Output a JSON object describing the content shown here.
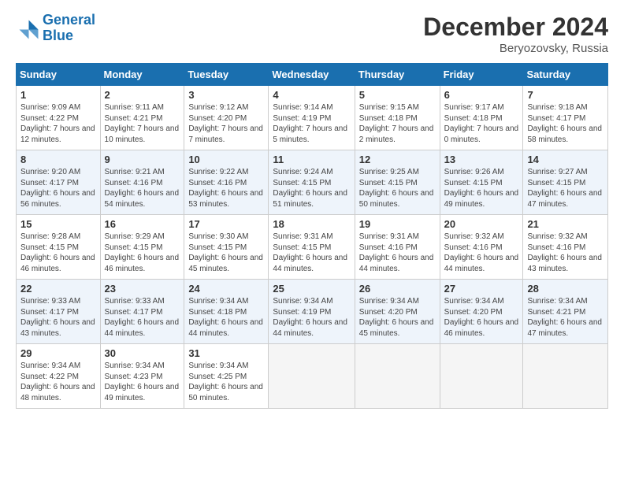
{
  "header": {
    "logo_line1": "General",
    "logo_line2": "Blue",
    "month": "December 2024",
    "location": "Beryozovsky, Russia"
  },
  "weekdays": [
    "Sunday",
    "Monday",
    "Tuesday",
    "Wednesday",
    "Thursday",
    "Friday",
    "Saturday"
  ],
  "weeks": [
    [
      {
        "day": "1",
        "sunrise": "Sunrise: 9:09 AM",
        "sunset": "Sunset: 4:22 PM",
        "daylight": "Daylight: 7 hours and 12 minutes."
      },
      {
        "day": "2",
        "sunrise": "Sunrise: 9:11 AM",
        "sunset": "Sunset: 4:21 PM",
        "daylight": "Daylight: 7 hours and 10 minutes."
      },
      {
        "day": "3",
        "sunrise": "Sunrise: 9:12 AM",
        "sunset": "Sunset: 4:20 PM",
        "daylight": "Daylight: 7 hours and 7 minutes."
      },
      {
        "day": "4",
        "sunrise": "Sunrise: 9:14 AM",
        "sunset": "Sunset: 4:19 PM",
        "daylight": "Daylight: 7 hours and 5 minutes."
      },
      {
        "day": "5",
        "sunrise": "Sunrise: 9:15 AM",
        "sunset": "Sunset: 4:18 PM",
        "daylight": "Daylight: 7 hours and 2 minutes."
      },
      {
        "day": "6",
        "sunrise": "Sunrise: 9:17 AM",
        "sunset": "Sunset: 4:18 PM",
        "daylight": "Daylight: 7 hours and 0 minutes."
      },
      {
        "day": "7",
        "sunrise": "Sunrise: 9:18 AM",
        "sunset": "Sunset: 4:17 PM",
        "daylight": "Daylight: 6 hours and 58 minutes."
      }
    ],
    [
      {
        "day": "8",
        "sunrise": "Sunrise: 9:20 AM",
        "sunset": "Sunset: 4:17 PM",
        "daylight": "Daylight: 6 hours and 56 minutes."
      },
      {
        "day": "9",
        "sunrise": "Sunrise: 9:21 AM",
        "sunset": "Sunset: 4:16 PM",
        "daylight": "Daylight: 6 hours and 54 minutes."
      },
      {
        "day": "10",
        "sunrise": "Sunrise: 9:22 AM",
        "sunset": "Sunset: 4:16 PM",
        "daylight": "Daylight: 6 hours and 53 minutes."
      },
      {
        "day": "11",
        "sunrise": "Sunrise: 9:24 AM",
        "sunset": "Sunset: 4:15 PM",
        "daylight": "Daylight: 6 hours and 51 minutes."
      },
      {
        "day": "12",
        "sunrise": "Sunrise: 9:25 AM",
        "sunset": "Sunset: 4:15 PM",
        "daylight": "Daylight: 6 hours and 50 minutes."
      },
      {
        "day": "13",
        "sunrise": "Sunrise: 9:26 AM",
        "sunset": "Sunset: 4:15 PM",
        "daylight": "Daylight: 6 hours and 49 minutes."
      },
      {
        "day": "14",
        "sunrise": "Sunrise: 9:27 AM",
        "sunset": "Sunset: 4:15 PM",
        "daylight": "Daylight: 6 hours and 47 minutes."
      }
    ],
    [
      {
        "day": "15",
        "sunrise": "Sunrise: 9:28 AM",
        "sunset": "Sunset: 4:15 PM",
        "daylight": "Daylight: 6 hours and 46 minutes."
      },
      {
        "day": "16",
        "sunrise": "Sunrise: 9:29 AM",
        "sunset": "Sunset: 4:15 PM",
        "daylight": "Daylight: 6 hours and 46 minutes."
      },
      {
        "day": "17",
        "sunrise": "Sunrise: 9:30 AM",
        "sunset": "Sunset: 4:15 PM",
        "daylight": "Daylight: 6 hours and 45 minutes."
      },
      {
        "day": "18",
        "sunrise": "Sunrise: 9:31 AM",
        "sunset": "Sunset: 4:15 PM",
        "daylight": "Daylight: 6 hours and 44 minutes."
      },
      {
        "day": "19",
        "sunrise": "Sunrise: 9:31 AM",
        "sunset": "Sunset: 4:16 PM",
        "daylight": "Daylight: 6 hours and 44 minutes."
      },
      {
        "day": "20",
        "sunrise": "Sunrise: 9:32 AM",
        "sunset": "Sunset: 4:16 PM",
        "daylight": "Daylight: 6 hours and 44 minutes."
      },
      {
        "day": "21",
        "sunrise": "Sunrise: 9:32 AM",
        "sunset": "Sunset: 4:16 PM",
        "daylight": "Daylight: 6 hours and 43 minutes."
      }
    ],
    [
      {
        "day": "22",
        "sunrise": "Sunrise: 9:33 AM",
        "sunset": "Sunset: 4:17 PM",
        "daylight": "Daylight: 6 hours and 43 minutes."
      },
      {
        "day": "23",
        "sunrise": "Sunrise: 9:33 AM",
        "sunset": "Sunset: 4:17 PM",
        "daylight": "Daylight: 6 hours and 44 minutes."
      },
      {
        "day": "24",
        "sunrise": "Sunrise: 9:34 AM",
        "sunset": "Sunset: 4:18 PM",
        "daylight": "Daylight: 6 hours and 44 minutes."
      },
      {
        "day": "25",
        "sunrise": "Sunrise: 9:34 AM",
        "sunset": "Sunset: 4:19 PM",
        "daylight": "Daylight: 6 hours and 44 minutes."
      },
      {
        "day": "26",
        "sunrise": "Sunrise: 9:34 AM",
        "sunset": "Sunset: 4:20 PM",
        "daylight": "Daylight: 6 hours and 45 minutes."
      },
      {
        "day": "27",
        "sunrise": "Sunrise: 9:34 AM",
        "sunset": "Sunset: 4:20 PM",
        "daylight": "Daylight: 6 hours and 46 minutes."
      },
      {
        "day": "28",
        "sunrise": "Sunrise: 9:34 AM",
        "sunset": "Sunset: 4:21 PM",
        "daylight": "Daylight: 6 hours and 47 minutes."
      }
    ],
    [
      {
        "day": "29",
        "sunrise": "Sunrise: 9:34 AM",
        "sunset": "Sunset: 4:22 PM",
        "daylight": "Daylight: 6 hours and 48 minutes."
      },
      {
        "day": "30",
        "sunrise": "Sunrise: 9:34 AM",
        "sunset": "Sunset: 4:23 PM",
        "daylight": "Daylight: 6 hours and 49 minutes."
      },
      {
        "day": "31",
        "sunrise": "Sunrise: 9:34 AM",
        "sunset": "Sunset: 4:25 PM",
        "daylight": "Daylight: 6 hours and 50 minutes."
      },
      null,
      null,
      null,
      null
    ]
  ]
}
